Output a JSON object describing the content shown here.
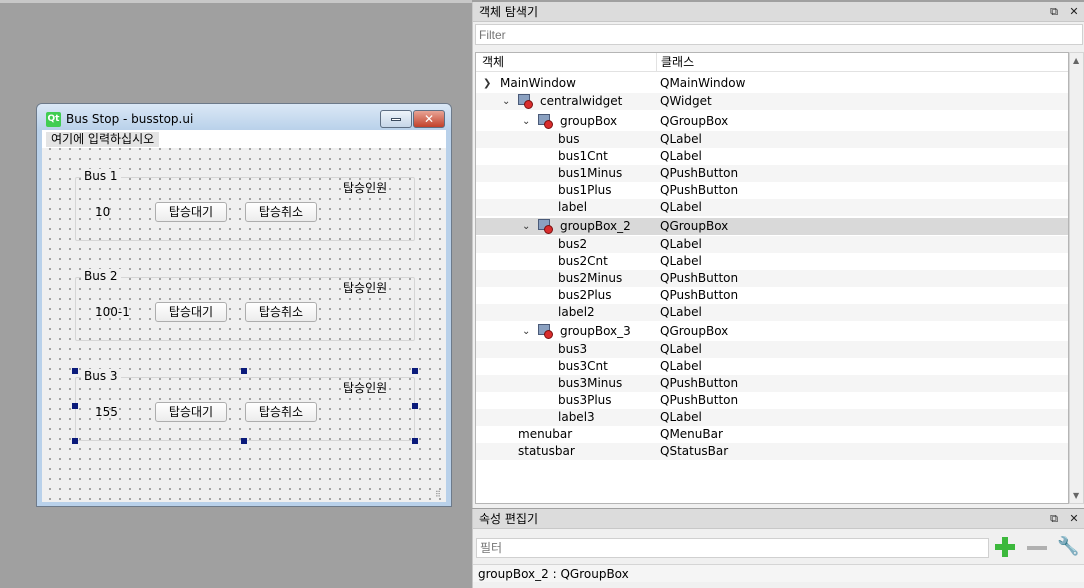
{
  "form_window": {
    "title": "Bus Stop - busstop.ui",
    "qt_icon_text": "Qt",
    "menu_placeholder": "여기에 입력하십시오",
    "groups": [
      {
        "title": "Bus 1",
        "count": "10",
        "wait_label": "탑승대기",
        "cancel_label": "탑승취소",
        "passenger_label": "탑승인원"
      },
      {
        "title": "Bus 2",
        "count": "100-1",
        "wait_label": "탑승대기",
        "cancel_label": "탑승취소",
        "passenger_label": "탑승인원"
      },
      {
        "title": "Bus 3",
        "count": "155",
        "wait_label": "탑승대기",
        "cancel_label": "탑승취소",
        "passenger_label": "탑승인원"
      }
    ]
  },
  "inspector": {
    "title": "객체 탐색기",
    "filter_placeholder": "Filter",
    "col_object": "객체",
    "col_class": "클래스",
    "rows": [
      {
        "name": "MainWindow",
        "cls": "QMainWindow"
      },
      {
        "name": "centralwidget",
        "cls": "QWidget"
      },
      {
        "name": "groupBox",
        "cls": "QGroupBox"
      },
      {
        "name": "bus",
        "cls": "QLabel"
      },
      {
        "name": "bus1Cnt",
        "cls": "QLabel"
      },
      {
        "name": "bus1Minus",
        "cls": "QPushButton"
      },
      {
        "name": "bus1Plus",
        "cls": "QPushButton"
      },
      {
        "name": "label",
        "cls": "QLabel"
      },
      {
        "name": "groupBox_2",
        "cls": "QGroupBox"
      },
      {
        "name": "bus2",
        "cls": "QLabel"
      },
      {
        "name": "bus2Cnt",
        "cls": "QLabel"
      },
      {
        "name": "bus2Minus",
        "cls": "QPushButton"
      },
      {
        "name": "bus2Plus",
        "cls": "QPushButton"
      },
      {
        "name": "label2",
        "cls": "QLabel"
      },
      {
        "name": "groupBox_3",
        "cls": "QGroupBox"
      },
      {
        "name": "bus3",
        "cls": "QLabel"
      },
      {
        "name": "bus3Cnt",
        "cls": "QLabel"
      },
      {
        "name": "bus3Minus",
        "cls": "QPushButton"
      },
      {
        "name": "bus3Plus",
        "cls": "QPushButton"
      },
      {
        "name": "label3",
        "cls": "QLabel"
      },
      {
        "name": "menubar",
        "cls": "QMenuBar"
      },
      {
        "name": "statusbar",
        "cls": "QStatusBar"
      }
    ]
  },
  "property_editor": {
    "title": "속성 편집기",
    "filter_placeholder": "필터",
    "status": "groupBox_2 : QGroupBox"
  }
}
